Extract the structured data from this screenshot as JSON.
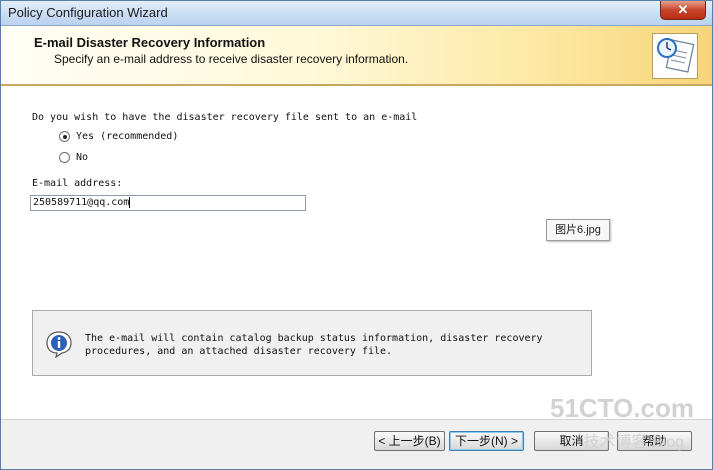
{
  "window": {
    "title": "Policy Configuration Wizard",
    "close_glyph": "✕"
  },
  "header": {
    "title": "E-mail Disaster Recovery Information",
    "subtitle": "Specify an e-mail address to receive disaster recovery information.",
    "icon": "report-clock-icon"
  },
  "form": {
    "question": "Do you wish to have the disaster recovery file sent to an e-mail",
    "options": [
      {
        "label": "Yes (recommended)",
        "selected": true
      },
      {
        "label": "No",
        "selected": false
      }
    ],
    "email_label": "E-mail address:",
    "email_value": "250589711@qq.com"
  },
  "image_tag": "图片6.jpg",
  "info": {
    "icon": "info-icon",
    "line1": "The e-mail will contain catalog backup status information, disaster recovery",
    "line2": "procedures, and an attached disaster recovery file."
  },
  "buttons": {
    "back": "< 上一步(B)",
    "next": "下一步(N) >",
    "cancel": "取消",
    "help": "帮助"
  },
  "watermark": {
    "line1": "51CTO.com",
    "line2": "技术博客 Blog"
  }
}
